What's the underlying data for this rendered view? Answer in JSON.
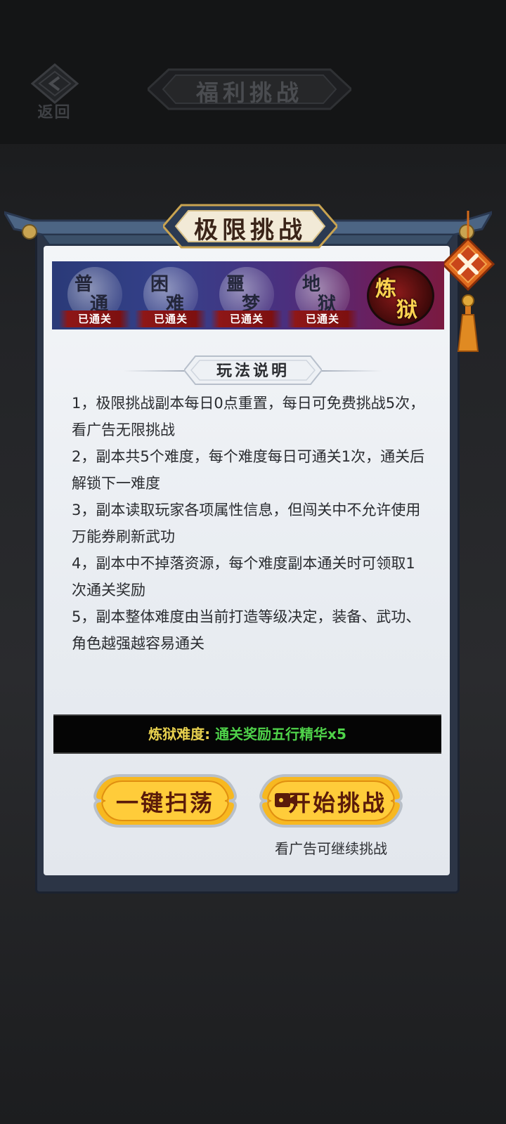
{
  "header": {
    "back_label": "返回",
    "page_title": "福利挑战"
  },
  "panel": {
    "title": "极限挑战",
    "close_icon": "close-knot-icon"
  },
  "tabs": [
    {
      "char1": "普",
      "char2": "通",
      "badge": "已通关",
      "state": "cleared"
    },
    {
      "char1": "困",
      "char2": "难",
      "badge": "已通关",
      "state": "cleared"
    },
    {
      "char1": "噩",
      "char2": "梦",
      "badge": "已通关",
      "state": "cleared"
    },
    {
      "char1": "地",
      "char2": "狱",
      "badge": "已通关",
      "state": "cleared"
    },
    {
      "char1": "炼",
      "char2": "狱",
      "state": "selected"
    }
  ],
  "section_title": "玩法说明",
  "rules": [
    "1，极限挑战副本每日0点重置，每日可免费挑战5次，看广告无限挑战",
    "2，副本共5个难度，每个难度每日可通关1次，通关后解锁下一难度",
    "3，副本读取玩家各项属性信息，但闯关中不允许使用万能券刷新武功",
    "4，副本中不掉落资源，每个难度副本通关时可领取1次通关奖励",
    "5，副本整体难度由当前打造等级决定，装备、武功、角色越强越容易通关"
  ],
  "reward": {
    "label": "炼狱难度: ",
    "value": "通关奖励五行精华x5"
  },
  "buttons": {
    "sweep_label": "一键扫荡",
    "start_label": "开始挑战",
    "ad_hint": "看广告可继续挑战"
  },
  "colors": {
    "reward_label": "#e9d24f",
    "reward_value": "#4fd34a",
    "button_gold": "#f7b820",
    "badge_red": "#8e1717",
    "panel_frame": "#2c3546"
  }
}
